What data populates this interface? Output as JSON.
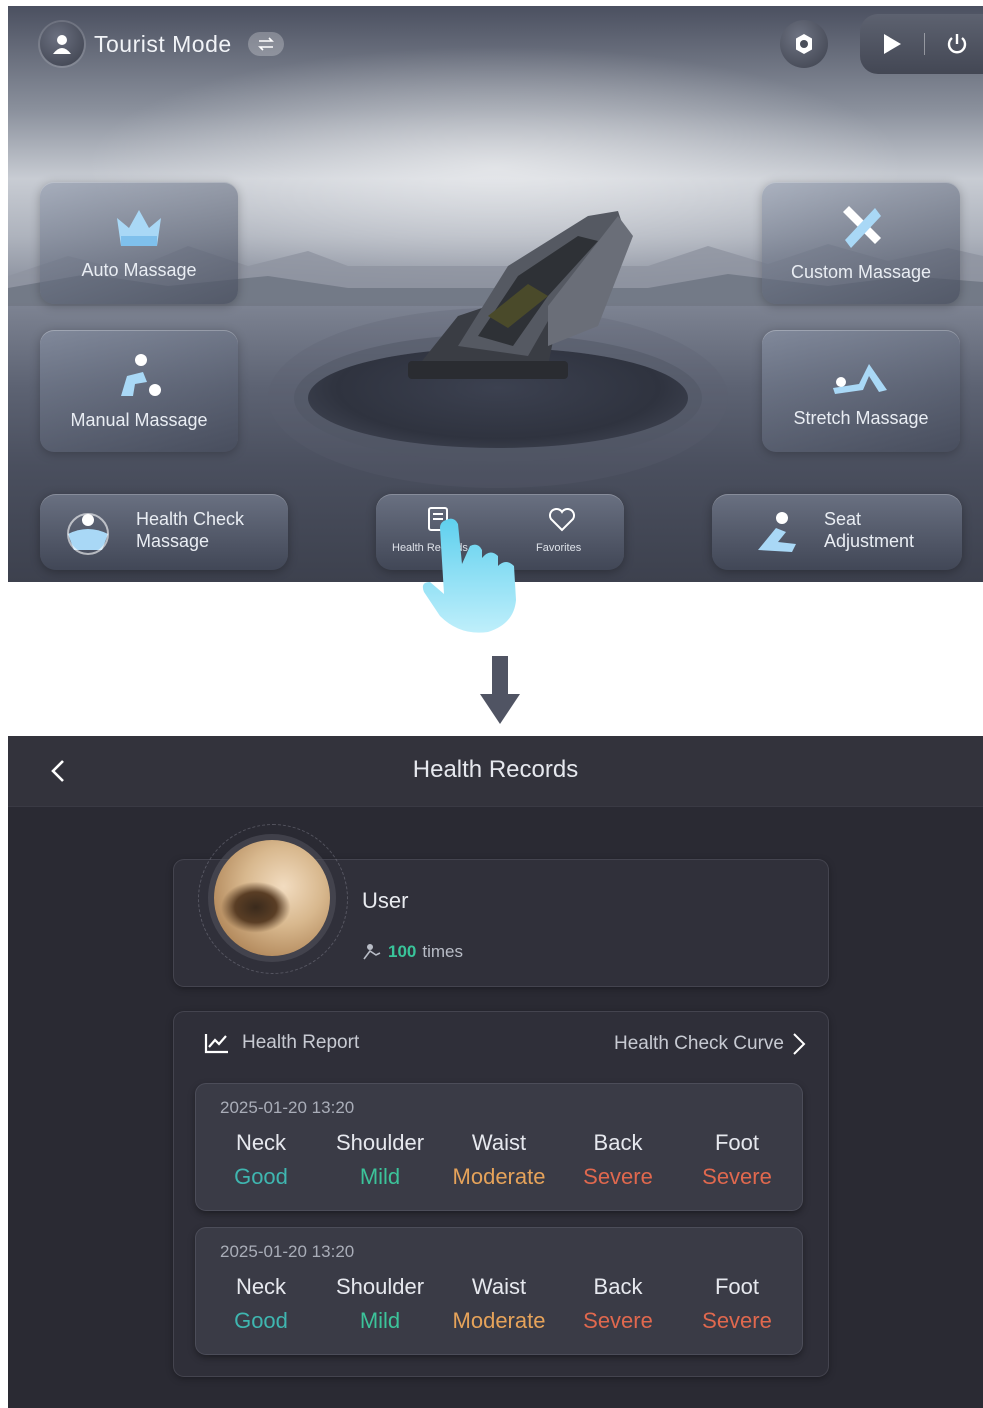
{
  "top": {
    "mode_label": "Tourist Mode",
    "modes": [
      {
        "label": "Auto Massage",
        "icon": "crown-icon"
      },
      {
        "label": "Custom Massage",
        "icon": "custom-tools-icon"
      },
      {
        "label": "Manual Massage",
        "icon": "manual-person-icon"
      },
      {
        "label": "Stretch Massage",
        "icon": "stretch-person-icon"
      }
    ],
    "health_check": {
      "line1": "Health Check",
      "line2": "Massage"
    },
    "seat": {
      "line1": "Seat",
      "line2": "Adjustment"
    },
    "center_left_label": "Health Records",
    "center_right_label": "Favorites"
  },
  "records_screen": {
    "title": "Health Records",
    "user": {
      "name": "User",
      "times_value": "100",
      "times_unit": "times"
    },
    "report": {
      "title": "Health Report",
      "curve_link": "Health Check Curve",
      "entries": [
        {
          "timestamp": "2025-01-20  13:20",
          "items": [
            {
              "part": "Neck",
              "level": "Good"
            },
            {
              "part": "Shoulder",
              "level": "Mild"
            },
            {
              "part": "Waist",
              "level": "Moderate"
            },
            {
              "part": "Back",
              "level": "Severe"
            },
            {
              "part": "Foot",
              "level": "Severe"
            }
          ]
        },
        {
          "timestamp": "2025-01-20  13:20",
          "items": [
            {
              "part": "Neck",
              "level": "Good"
            },
            {
              "part": "Shoulder",
              "level": "Mild"
            },
            {
              "part": "Waist",
              "level": "Moderate"
            },
            {
              "part": "Back",
              "level": "Severe"
            },
            {
              "part": "Foot",
              "level": "Severe"
            }
          ]
        }
      ]
    }
  },
  "colors": {
    "good": "#3fb6b0",
    "mild": "#3cc39a",
    "moderate": "#e6a35a",
    "severe": "#e0684e",
    "accent_green": "#39c49a"
  }
}
